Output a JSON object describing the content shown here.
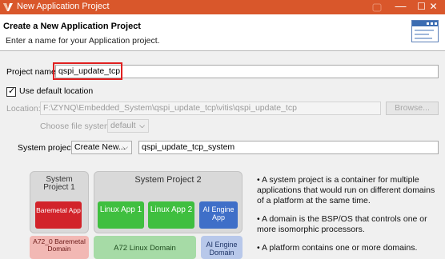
{
  "window": {
    "title": "New Application Project",
    "minimize_glyph": "—",
    "maximize_glyph": "☐",
    "close_glyph": "✕"
  },
  "header": {
    "title": "Create a New Application Project",
    "description": "Enter a name for your Application project."
  },
  "form": {
    "project_name_label": "Project name:",
    "project_name_value": "qspi_update_tcp",
    "use_default_label": "Use default location",
    "use_default_checked": true,
    "location_label": "Location:",
    "location_value": "F:\\ZYNQ\\Embedded_System\\qspi_update_tcp\\vitis\\qspi_update_tcp",
    "browse_label": "Browse...",
    "filesystem_label": "Choose file system:",
    "filesystem_value": "default",
    "system_project_label": "System project:",
    "system_project_select": "Create New...",
    "system_project_name": "qspi_update_tcp_system"
  },
  "diagram": {
    "system_project_1": "System Project 1",
    "system_project_2": "System Project 2",
    "baremetal_app": "Baremetal App",
    "linux_app_1": "Linux App 1",
    "linux_app_2": "Linux App 2",
    "ai_engine_app": "AI Engine App",
    "a72_baremetal_domain": "A72_0 Baremetal Domain",
    "a72_linux_domain": "A72 Linux Domain",
    "ai_engine_domain": "AI Engine Domain",
    "colors": {
      "tile_red": "#d2232a",
      "tile_green": "#3fbf3f",
      "tile_blue": "#3f6fc8",
      "sys_box": "#d9d9d9",
      "domain_pink": "#f2b8b4",
      "domain_green": "#a6dba6",
      "domain_blue": "#b8c8ea"
    }
  },
  "info_bullets": [
    "• A system project is a container for multiple applications that would run on different domains of a platform at the same time.",
    "• A domain is the BSP/OS that controls one or more isomorphic processors.",
    "• A platform contains one or more domains."
  ]
}
